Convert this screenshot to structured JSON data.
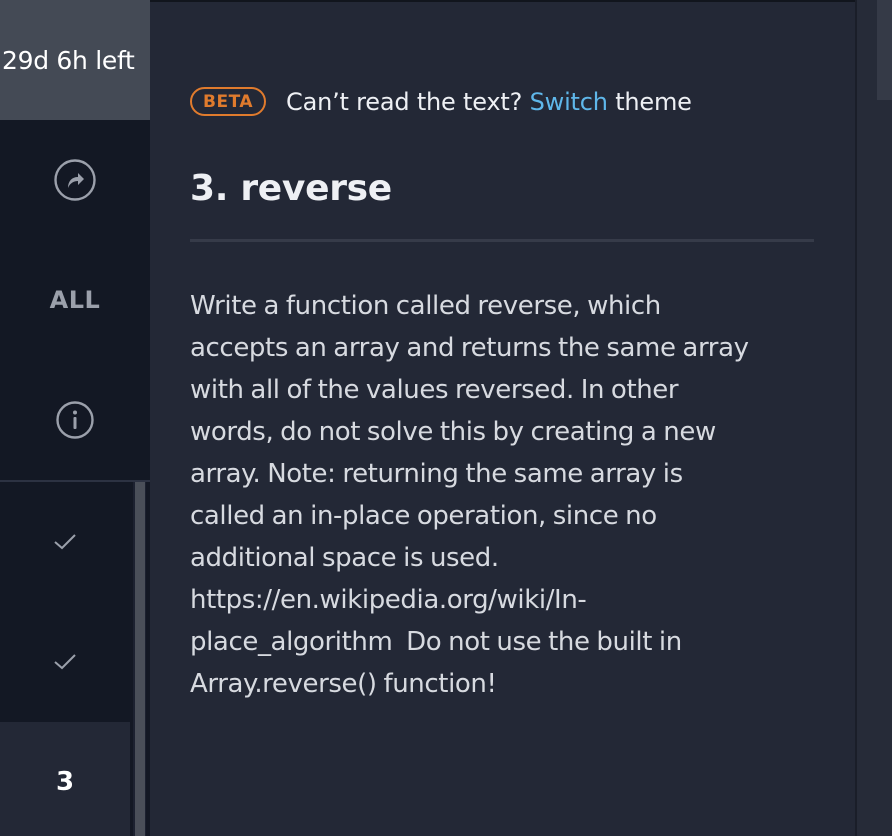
{
  "timer": {
    "label": "29d 6h left"
  },
  "sidebar": {
    "all_label": "ALL",
    "problems": [
      {
        "status": "done",
        "icon": "check-icon"
      },
      {
        "status": "done",
        "icon": "check-icon"
      },
      {
        "status": "current",
        "number": "3"
      }
    ]
  },
  "banner": {
    "badge": "BETA",
    "prefix": "Can’t read the text?",
    "link": "Switch",
    "suffix": "theme"
  },
  "problem": {
    "title": "3. reverse",
    "description_lines": [
      "Write a function called reverse, which",
      "accepts an array and returns the same array",
      "with all of the values reversed. In other",
      "words, do not solve this by creating a new",
      "array. Note: returning the same array is",
      "called an in-place operation, since no",
      "additional space is used.",
      "https://en.wikipedia.org/wiki/In-",
      "place_algorithm  Do not use the built in",
      "Array.reverse() function!"
    ]
  },
  "colors": {
    "accent_orange": "#e07b2d",
    "link_blue": "#5fb7ea",
    "background": "#232836",
    "sidebar": "#131824"
  }
}
